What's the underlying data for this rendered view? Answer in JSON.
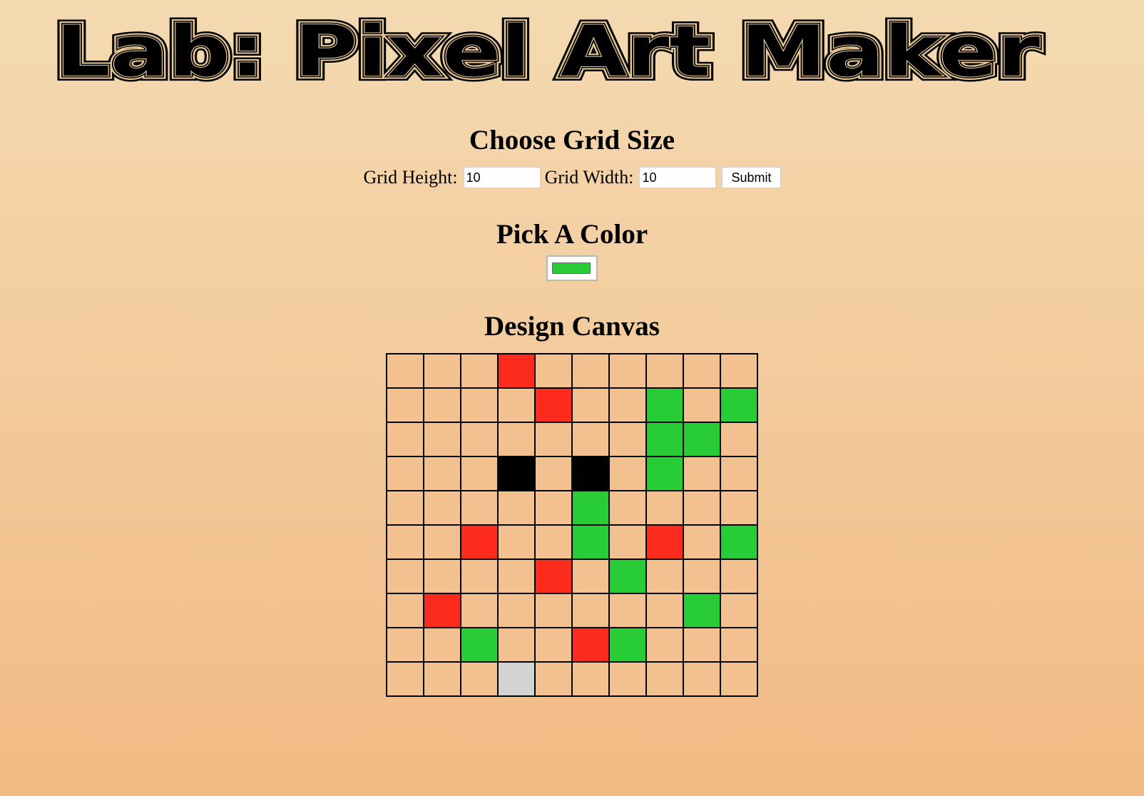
{
  "page": {
    "title": "Lab: Pixel Art Maker"
  },
  "grid_size": {
    "heading": "Choose Grid Size",
    "height_label": "Grid Height:",
    "height_value": "10",
    "width_label": "Grid Width:",
    "width_value": "10",
    "submit_label": "Submit"
  },
  "color_picker": {
    "heading": "Pick A Color",
    "selected_color": "#28cc36"
  },
  "canvas": {
    "heading": "Design Canvas",
    "rows": 10,
    "cols": 10,
    "palette": {
      "empty": "#f3c18f",
      "red": "#fc2b1e",
      "green": "#28cc36",
      "black": "#000000",
      "gray": "#d3d3d3"
    },
    "cells": [
      [
        "empty",
        "empty",
        "empty",
        "red",
        "empty",
        "empty",
        "empty",
        "empty",
        "empty",
        "empty"
      ],
      [
        "empty",
        "empty",
        "empty",
        "empty",
        "red",
        "empty",
        "empty",
        "green",
        "empty",
        "green"
      ],
      [
        "empty",
        "empty",
        "empty",
        "empty",
        "empty",
        "empty",
        "empty",
        "green",
        "green",
        "empty"
      ],
      [
        "empty",
        "empty",
        "empty",
        "black",
        "empty",
        "black",
        "empty",
        "green",
        "empty",
        "empty"
      ],
      [
        "empty",
        "empty",
        "empty",
        "empty",
        "empty",
        "green",
        "empty",
        "empty",
        "empty",
        "empty"
      ],
      [
        "empty",
        "empty",
        "red",
        "empty",
        "empty",
        "green",
        "empty",
        "red",
        "empty",
        "green"
      ],
      [
        "empty",
        "empty",
        "empty",
        "empty",
        "red",
        "empty",
        "green",
        "empty",
        "empty",
        "empty"
      ],
      [
        "empty",
        "red",
        "empty",
        "empty",
        "empty",
        "empty",
        "empty",
        "empty",
        "green",
        "empty"
      ],
      [
        "empty",
        "empty",
        "green",
        "empty",
        "empty",
        "red",
        "green",
        "empty",
        "empty",
        "empty"
      ],
      [
        "empty",
        "empty",
        "empty",
        "gray",
        "empty",
        "empty",
        "empty",
        "empty",
        "empty",
        "empty"
      ]
    ]
  }
}
